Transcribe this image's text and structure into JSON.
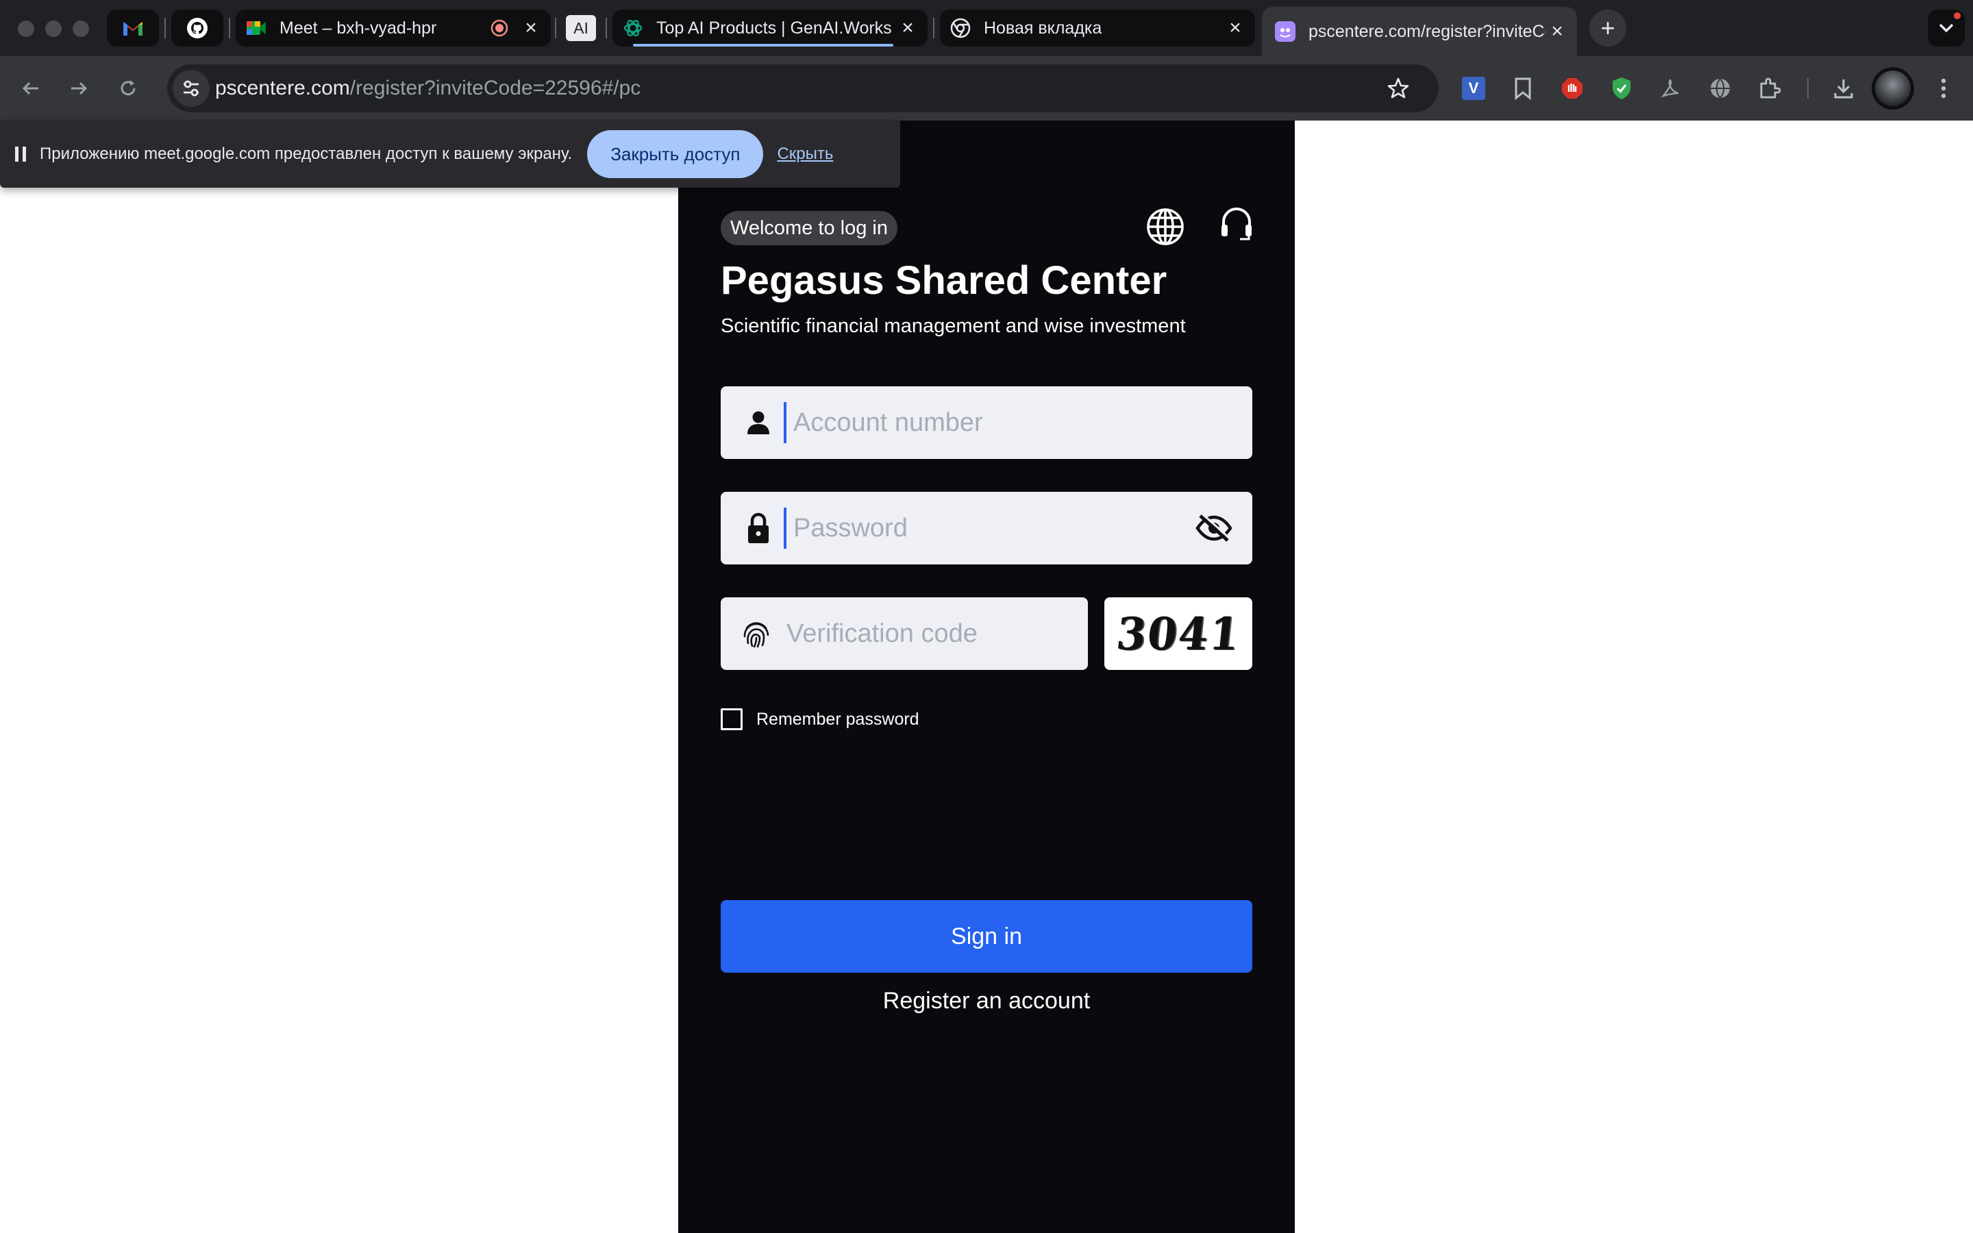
{
  "browser": {
    "tabs": [
      {
        "id": "gmail",
        "title": "",
        "icon": "gmail-icon",
        "pinned": true
      },
      {
        "id": "github",
        "title": "",
        "icon": "github-icon",
        "pinned": true
      },
      {
        "id": "meet",
        "title": "Meet – bxh-vyad-hpr",
        "icon": "google-meet-icon",
        "recording": true
      },
      {
        "id": "ai",
        "title": "",
        "icon_text": "AI",
        "pinned": true
      },
      {
        "id": "genai",
        "title": "Top AI Products | GenAI.Works",
        "icon": "openai-icon"
      },
      {
        "id": "newtab",
        "title": "Новая вкладка",
        "icon": "chrome-icon"
      },
      {
        "id": "pscentere",
        "title": "pscentere.com/register?inviteCode",
        "icon": "site-icon",
        "active": true
      }
    ],
    "address_bar": {
      "host": "pscentere.com",
      "path": "/register?inviteCode=22596#/pc"
    }
  },
  "share_banner": {
    "message": "Приложению meet.google.com предоставлен доступ к вашему экрану.",
    "stop_label": "Закрыть доступ",
    "hide_label": "Скрыть"
  },
  "login": {
    "welcome": "Welcome to log in",
    "title": "Pegasus Shared Center",
    "subtitle": "Scientific financial management and wise investment",
    "account_placeholder": "Account number",
    "password_placeholder": "Password",
    "code_placeholder": "Verification code",
    "captcha": "3041",
    "remember_label": "Remember password",
    "signin_label": "Sign in",
    "register_label": "Register an account"
  },
  "colors": {
    "page_bg": "#0a0a0e",
    "primary": "#2563f0",
    "input_bg": "#eef0f6",
    "banner_button": "#a8c7fa"
  }
}
